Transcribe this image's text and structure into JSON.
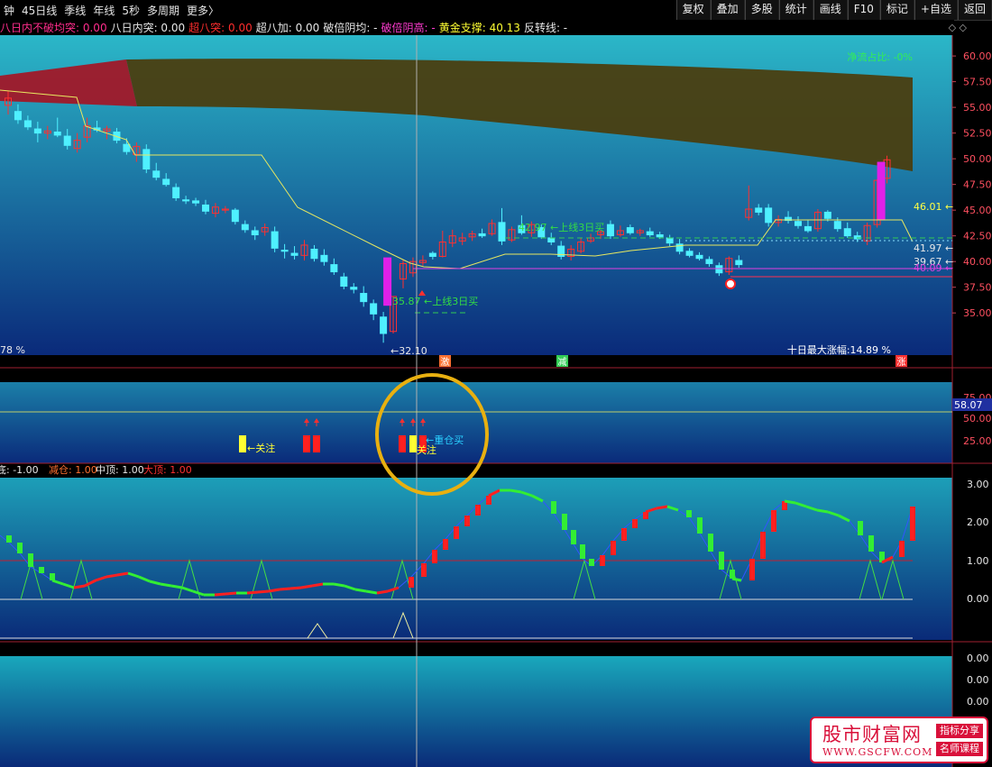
{
  "toolbar": {
    "items": [
      "钟",
      "45日线",
      "季线",
      "年线",
      "5秒",
      "多周期",
      "更多〉"
    ],
    "buttons": [
      "复权",
      "叠加",
      "多股",
      "统计",
      "画线",
      "F10",
      "标记",
      "+自选",
      "返回"
    ]
  },
  "indicator_bar": [
    {
      "text": "八日内不破均突: 0.00",
      "color": "#ff2d8c"
    },
    {
      "text": "八日内突: 0.00",
      "color": "#e8e8e8"
    },
    {
      "text": "超八突: 0.00",
      "color": "#ff2d2d"
    },
    {
      "text": "超八加: 0.00",
      "color": "#e8e8e8"
    },
    {
      "text": "破倍阴均: -",
      "color": "#e8e8e8"
    },
    {
      "text": "破倍阴高: -",
      "color": "#ff3bd0"
    },
    {
      "text": "黄金支撑: 40.13",
      "color": "#ffff33"
    },
    {
      "text": "反转线: -",
      "color": "#e8e8e8"
    }
  ],
  "nav_arrows": "◇ ◇",
  "colors": {
    "bg": "#000000",
    "panel_top": "#2bb7c8",
    "panel_bottom": "#0a2a7a",
    "up_candle": "#ff3030",
    "down_candle": "#4ff0ff",
    "magenta": "#e020e8",
    "yellow_line": "#e8e860",
    "band_red": "#a01828",
    "band_olive": "#4a3e10"
  },
  "main": {
    "right_axis": [
      "60.00",
      "57.50",
      "55.00",
      "52.50",
      "50.00",
      "47.50",
      "45.00",
      "42.50",
      "40.00",
      "37.50",
      "35.00"
    ],
    "net_flow_label": "净流占比: -0%",
    "left_pct": "78 %",
    "max_gain_label": "十日最大涨幅:14.89 %",
    "annotations": [
      "35.87 ←上线3日买",
      "42.97 ←上线3日买",
      "←32.10",
      "46.01 ←",
      "41.97 ←",
      "39.67 ←",
      "40.09 ←"
    ],
    "bottom_tags": [
      "激",
      "减",
      "涨"
    ],
    "candles": [
      {
        "o": 55.2,
        "h": 56.6,
        "l": 54.3,
        "c": 55.9
      },
      {
        "o": 54.6,
        "h": 55.3,
        "l": 53.4,
        "c": 53.8
      },
      {
        "o": 53.7,
        "h": 54.2,
        "l": 52.8,
        "c": 53.1
      },
      {
        "o": 52.9,
        "h": 53.6,
        "l": 51.6,
        "c": 52.5
      },
      {
        "o": 52.5,
        "h": 53.2,
        "l": 51.9,
        "c": 52.7
      },
      {
        "o": 52.6,
        "h": 54.0,
        "l": 52.1,
        "c": 52.3
      },
      {
        "o": 52.2,
        "h": 52.9,
        "l": 50.9,
        "c": 51.3
      },
      {
        "o": 51.0,
        "h": 52.5,
        "l": 50.6,
        "c": 51.8
      },
      {
        "o": 52.1,
        "h": 54.0,
        "l": 51.6,
        "c": 53.2
      },
      {
        "o": 53.0,
        "h": 53.7,
        "l": 52.6,
        "c": 52.8
      },
      {
        "o": 52.7,
        "h": 53.2,
        "l": 51.9,
        "c": 52.9
      },
      {
        "o": 52.6,
        "h": 53.0,
        "l": 51.5,
        "c": 51.8
      },
      {
        "o": 51.4,
        "h": 52.0,
        "l": 50.4,
        "c": 50.7
      },
      {
        "o": 50.4,
        "h": 51.6,
        "l": 49.7,
        "c": 51.2
      },
      {
        "o": 50.9,
        "h": 51.4,
        "l": 48.6,
        "c": 49.0
      },
      {
        "o": 48.8,
        "h": 49.6,
        "l": 47.9,
        "c": 48.2
      },
      {
        "o": 48.0,
        "h": 48.6,
        "l": 47.3,
        "c": 47.5
      },
      {
        "o": 47.2,
        "h": 47.6,
        "l": 45.9,
        "c": 46.2
      },
      {
        "o": 46.0,
        "h": 46.4,
        "l": 45.6,
        "c": 45.9
      },
      {
        "o": 45.9,
        "h": 46.2,
        "l": 45.4,
        "c": 45.7
      },
      {
        "o": 45.5,
        "h": 46.0,
        "l": 44.6,
        "c": 44.9
      },
      {
        "o": 44.7,
        "h": 45.7,
        "l": 44.3,
        "c": 45.3
      },
      {
        "o": 45.0,
        "h": 45.4,
        "l": 44.7,
        "c": 45.1
      },
      {
        "o": 45.0,
        "h": 45.2,
        "l": 43.6,
        "c": 43.9
      },
      {
        "o": 43.6,
        "h": 44.0,
        "l": 42.8,
        "c": 43.1
      },
      {
        "o": 43.0,
        "h": 43.4,
        "l": 42.1,
        "c": 42.6
      },
      {
        "o": 42.9,
        "h": 43.7,
        "l": 42.5,
        "c": 43.3
      },
      {
        "o": 42.9,
        "h": 43.4,
        "l": 40.9,
        "c": 41.3
      },
      {
        "o": 41.1,
        "h": 41.7,
        "l": 40.3,
        "c": 41.0
      },
      {
        "o": 40.8,
        "h": 41.5,
        "l": 40.2,
        "c": 40.6
      },
      {
        "o": 40.6,
        "h": 42.1,
        "l": 40.1,
        "c": 41.6
      },
      {
        "o": 41.2,
        "h": 41.6,
        "l": 40.0,
        "c": 40.3
      },
      {
        "o": 40.6,
        "h": 41.2,
        "l": 39.6,
        "c": 40.0
      },
      {
        "o": 39.7,
        "h": 40.3,
        "l": 38.7,
        "c": 39.0
      },
      {
        "o": 38.5,
        "h": 38.9,
        "l": 37.3,
        "c": 37.6
      },
      {
        "o": 37.5,
        "h": 37.9,
        "l": 36.9,
        "c": 37.3
      },
      {
        "o": 36.9,
        "h": 37.6,
        "l": 35.6,
        "c": 36.1
      },
      {
        "o": 35.9,
        "h": 36.3,
        "l": 34.3,
        "c": 34.9
      },
      {
        "o": 34.6,
        "h": 35.1,
        "l": 32.1,
        "c": 33.0
      },
      {
        "o": 33.2,
        "h": 36.6,
        "l": 33.0,
        "c": 36.6
      },
      {
        "o": 38.3,
        "h": 40.2,
        "l": 37.4,
        "c": 39.8
      },
      {
        "o": 38.9,
        "h": 40.4,
        "l": 38.5,
        "c": 40.0
      },
      {
        "o": 39.9,
        "h": 40.6,
        "l": 39.6,
        "c": 40.1
      },
      {
        "o": 40.8,
        "h": 41.0,
        "l": 40.2,
        "c": 40.5
      },
      {
        "o": 40.5,
        "h": 43.0,
        "l": 40.4,
        "c": 41.9
      },
      {
        "o": 41.8,
        "h": 43.1,
        "l": 41.4,
        "c": 42.5
      },
      {
        "o": 42.0,
        "h": 42.8,
        "l": 41.6,
        "c": 42.3
      },
      {
        "o": 42.4,
        "h": 43.0,
        "l": 42.0,
        "c": 42.7
      },
      {
        "o": 42.7,
        "h": 43.2,
        "l": 42.3,
        "c": 42.5
      },
      {
        "o": 42.7,
        "h": 44.1,
        "l": 42.5,
        "c": 43.7
      },
      {
        "o": 43.8,
        "h": 45.2,
        "l": 41.6,
        "c": 42.0
      },
      {
        "o": 42.1,
        "h": 43.4,
        "l": 41.9,
        "c": 43.1
      },
      {
        "o": 43.5,
        "h": 44.5,
        "l": 42.6,
        "c": 42.8
      },
      {
        "o": 42.8,
        "h": 43.9,
        "l": 42.4,
        "c": 43.6
      },
      {
        "o": 43.3,
        "h": 43.6,
        "l": 42.2,
        "c": 42.4
      },
      {
        "o": 42.3,
        "h": 42.8,
        "l": 41.6,
        "c": 41.9
      },
      {
        "o": 41.5,
        "h": 42.0,
        "l": 40.2,
        "c": 40.5
      },
      {
        "o": 40.5,
        "h": 41.6,
        "l": 40.1,
        "c": 41.2
      },
      {
        "o": 41.0,
        "h": 42.3,
        "l": 40.8,
        "c": 41.9
      },
      {
        "o": 42.0,
        "h": 42.7,
        "l": 41.8,
        "c": 42.3
      },
      {
        "o": 42.6,
        "h": 43.1,
        "l": 42.2,
        "c": 42.9
      },
      {
        "o": 43.6,
        "h": 44.0,
        "l": 42.2,
        "c": 42.5
      },
      {
        "o": 42.6,
        "h": 43.5,
        "l": 42.4,
        "c": 43.0
      },
      {
        "o": 43.3,
        "h": 43.6,
        "l": 42.6,
        "c": 42.8
      },
      {
        "o": 42.8,
        "h": 43.2,
        "l": 42.5,
        "c": 43.0
      },
      {
        "o": 42.9,
        "h": 43.3,
        "l": 42.4,
        "c": 42.6
      },
      {
        "o": 42.6,
        "h": 42.9,
        "l": 42.2,
        "c": 42.4
      },
      {
        "o": 42.3,
        "h": 42.6,
        "l": 41.5,
        "c": 41.8
      },
      {
        "o": 41.7,
        "h": 42.2,
        "l": 40.7,
        "c": 41.0
      },
      {
        "o": 41.0,
        "h": 41.3,
        "l": 40.4,
        "c": 40.6
      },
      {
        "o": 40.6,
        "h": 40.9,
        "l": 40.1,
        "c": 40.3
      },
      {
        "o": 40.2,
        "h": 40.5,
        "l": 39.5,
        "c": 39.8
      },
      {
        "o": 39.6,
        "h": 39.9,
        "l": 38.6,
        "c": 38.9
      },
      {
        "o": 39.0,
        "h": 40.5,
        "l": 38.7,
        "c": 40.3
      },
      {
        "o": 40.1,
        "h": 40.6,
        "l": 39.4,
        "c": 39.7
      },
      {
        "o": 44.3,
        "h": 47.4,
        "l": 44.0,
        "c": 45.1
      },
      {
        "o": 45.2,
        "h": 45.6,
        "l": 44.5,
        "c": 44.8
      },
      {
        "o": 45.2,
        "h": 45.6,
        "l": 43.4,
        "c": 43.8
      },
      {
        "o": 43.8,
        "h": 44.5,
        "l": 43.4,
        "c": 44.1
      },
      {
        "o": 44.3,
        "h": 44.9,
        "l": 43.7,
        "c": 44.0
      },
      {
        "o": 43.9,
        "h": 44.4,
        "l": 43.2,
        "c": 43.5
      },
      {
        "o": 43.4,
        "h": 44.0,
        "l": 42.8,
        "c": 43.0
      },
      {
        "o": 43.2,
        "h": 45.1,
        "l": 42.9,
        "c": 44.8
      },
      {
        "o": 44.8,
        "h": 45.0,
        "l": 43.9,
        "c": 44.2
      },
      {
        "o": 43.9,
        "h": 44.3,
        "l": 42.9,
        "c": 43.2
      },
      {
        "o": 43.2,
        "h": 43.8,
        "l": 42.3,
        "c": 42.5
      },
      {
        "o": 42.5,
        "h": 42.9,
        "l": 41.9,
        "c": 42.2
      },
      {
        "o": 42.0,
        "h": 43.8,
        "l": 41.6,
        "c": 43.5
      },
      {
        "o": 43.6,
        "h": 48.0,
        "l": 43.3,
        "c": 47.9
      },
      {
        "o": 48.1,
        "h": 50.3,
        "l": 47.6,
        "c": 49.9
      }
    ]
  },
  "middle": {
    "right_axis": [
      "75.00",
      "50.00",
      "25.00"
    ],
    "value_box": "58.07",
    "labels": [
      "关注",
      "重仓买",
      "关注"
    ]
  },
  "lower": {
    "legend": [
      {
        "text": "底: -1.00",
        "color": "#e8e8e8"
      },
      {
        "text": "减仓: 1.00",
        "color": "#ff7030"
      },
      {
        "text": "中顶: 1.00",
        "color": "#e8e8e8"
      },
      {
        "text": "大顶: 1.00",
        "color": "#ff3030"
      }
    ],
    "right_axis": [
      "3.00",
      "2.00",
      "1.00",
      "0.00"
    ]
  },
  "bottom": {
    "right_axis": [
      "0.00",
      "0.00",
      "0.00"
    ]
  },
  "watermark": {
    "title": "股市财富网",
    "url": "WWW.GSCFW.COM",
    "tag1": "指标分享",
    "tag2": "名师课程"
  }
}
